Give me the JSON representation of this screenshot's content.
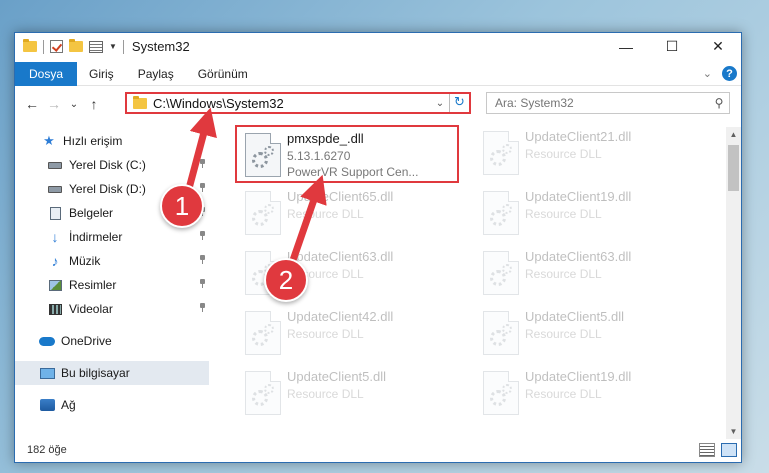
{
  "window": {
    "title": "System32",
    "controls": {
      "minimize": "—",
      "maximize": "☐",
      "close": "✕"
    }
  },
  "ribbon": {
    "tabs": [
      {
        "label": "Dosya",
        "active": true
      },
      {
        "label": "Giriş"
      },
      {
        "label": "Paylaş"
      },
      {
        "label": "Görünüm"
      }
    ],
    "expand_icon": "chevron-down-icon",
    "help_label": "?"
  },
  "nav": {
    "back": "←",
    "forward": "→",
    "recent": "⌄",
    "up": "↑",
    "address": "C:\\Windows\\System32",
    "refresh": "↻",
    "search_placeholder": "Ara: System32"
  },
  "sidebar": {
    "items": [
      {
        "label": "Hızlı erişim",
        "icon": "star-icon",
        "pinned": false
      },
      {
        "label": "Yerel Disk (C:)",
        "icon": "disk-icon",
        "pinned": true
      },
      {
        "label": "Yerel Disk (D:)",
        "icon": "disk-icon",
        "pinned": true
      },
      {
        "label": "Belgeler",
        "icon": "document-icon",
        "pinned": true
      },
      {
        "label": "İndirmeler",
        "icon": "download-icon",
        "pinned": true
      },
      {
        "label": "Müzik",
        "icon": "music-icon",
        "pinned": true
      },
      {
        "label": "Resimler",
        "icon": "picture-icon",
        "pinned": true
      },
      {
        "label": "Videolar",
        "icon": "video-icon",
        "pinned": true
      },
      {
        "label": "OneDrive",
        "icon": "cloud-icon",
        "pinned": false
      },
      {
        "label": "Bu bilgisayar",
        "icon": "computer-icon",
        "pinned": false,
        "selected": true
      },
      {
        "label": "Ağ",
        "icon": "network-icon",
        "pinned": false
      }
    ]
  },
  "files": [
    {
      "name": "pmxspde_.dll",
      "line2": "5.13.1.6270",
      "line3": "PowerVR Support Cen...",
      "highlighted": true
    },
    {
      "name": "UpdateClient21.dll",
      "line2": "Resource DLL"
    },
    {
      "name": "UpdateClient65.dll",
      "line2": "Resource DLL"
    },
    {
      "name": "UpdateClient19.dll",
      "line2": "Resource DLL"
    },
    {
      "name": "UpdateClient63.dll",
      "line2": "Resource DLL"
    },
    {
      "name": "UpdateClient63.dll",
      "line2": "Resource DLL"
    },
    {
      "name": "UpdateClient42.dll",
      "line2": "Resource DLL"
    },
    {
      "name": "UpdateClient5.dll",
      "line2": "Resource DLL"
    },
    {
      "name": "UpdateClient5.dll",
      "line2": "Resource DLL"
    },
    {
      "name": "UpdateClient19.dll",
      "line2": "Resource DLL"
    }
  ],
  "status": {
    "count": "182 öğe"
  },
  "annotations": {
    "step1": "1",
    "step2": "2",
    "color": "#e0393e"
  }
}
